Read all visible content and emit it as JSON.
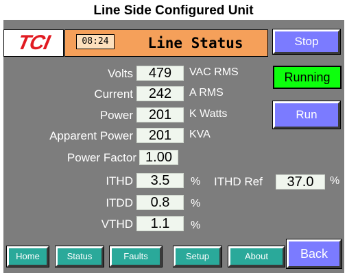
{
  "caption": "Line Side Configured Unit",
  "header": {
    "logo_text": "TCI",
    "time": "08:24",
    "screen_title": "Line Status",
    "stop_label": "Stop"
  },
  "status": {
    "state": "Running",
    "run_label": "Run"
  },
  "readings": {
    "volts": {
      "label": "Volts",
      "value": "479",
      "unit": "VAC RMS"
    },
    "current": {
      "label": "Current",
      "value": "242",
      "unit": "A RMS"
    },
    "power": {
      "label": "Power",
      "value": "201",
      "unit": "K Watts"
    },
    "apparent_power": {
      "label": "Apparent Power",
      "value": "201",
      "unit": "KVA"
    },
    "power_factor": {
      "label": "Power Factor",
      "value": "1.00"
    },
    "ithd": {
      "label": "ITHD",
      "value": "3.5",
      "unit": "%"
    },
    "ithd_ref": {
      "label": "ITHD Ref",
      "value": "37.0",
      "unit": "%"
    },
    "itdd": {
      "label": "ITDD",
      "value": "0.8",
      "unit": "%"
    },
    "vthd": {
      "label": "VTHD",
      "value": "1.1",
      "unit": "%"
    }
  },
  "nav": {
    "home": "Home",
    "status": "Status",
    "faults": "Faults",
    "setup": "Setup",
    "about": "About",
    "back": "Back"
  },
  "colors": {
    "panel_bg": "#7d7d7d",
    "title_bar": "#f5a05a",
    "button_blue": "#7b7bff",
    "button_teal": "#2aa99a",
    "running_green": "#0dff0d",
    "logo_red": "#e11b22"
  }
}
